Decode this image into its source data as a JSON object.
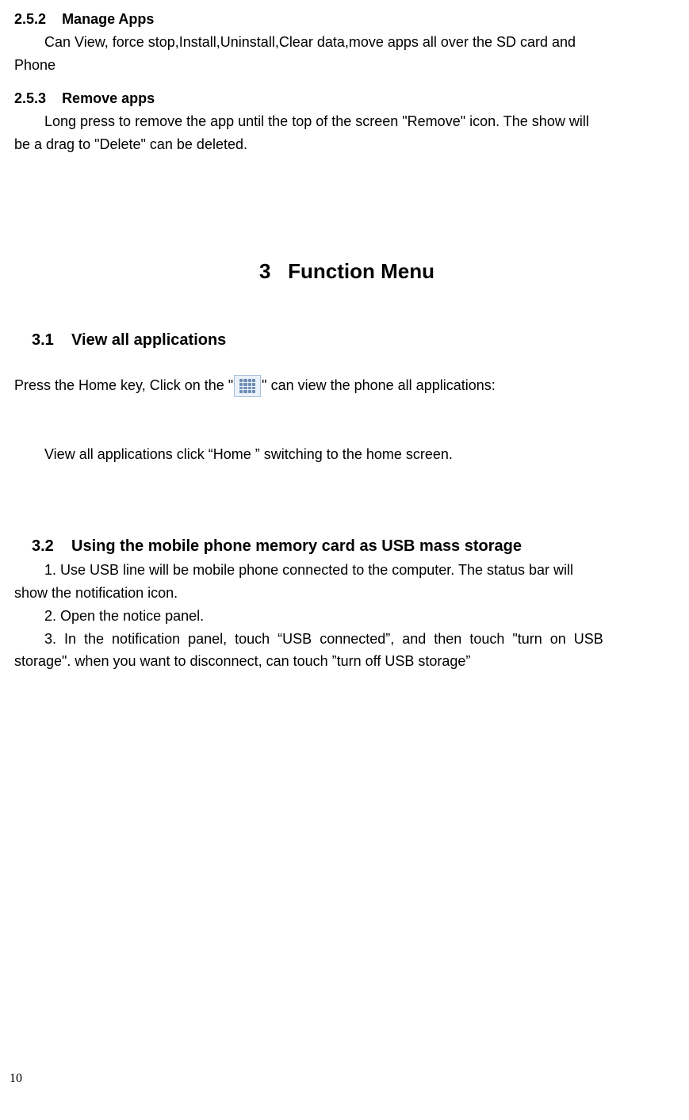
{
  "sec252": {
    "number": "2.5.2",
    "title": "Manage Apps",
    "body_line1": "Can View, force stop,Install,Uninstall,Clear data,move apps all over the SD card and",
    "body_line2": "Phone"
  },
  "sec253": {
    "number": "2.5.3",
    "title": "Remove apps",
    "body_line1": "Long press to remove the app until the top of the screen \"Remove\" icon. The show will",
    "body_line2": "be a drag to \"Delete\" can be deleted."
  },
  "chapter3": {
    "number": "3",
    "title": "Function Menu"
  },
  "sec31": {
    "number": "3.1",
    "title": "View all applications",
    "body_pre": "Press the Home key, Click on the \"",
    "body_post": "\" can view the phone all applications:",
    "body_switch": "View all applications click “Home ” switching to the home screen."
  },
  "sec32": {
    "number": "3.2",
    "title": "Using the mobile phone memory card as USB mass storage",
    "item1_line1": "1. Use USB line will be mobile phone connected to the computer. The status bar will",
    "item1_line2": "show the notification icon.",
    "item2": "2. Open the notice panel.",
    "item3_line1": "3. In the notification panel, touch “USB connected”, and then touch \"turn on USB",
    "item3_line2": "storage\". when you want to disconnect, can touch ”turn off USB storage”"
  },
  "page_number": "10"
}
